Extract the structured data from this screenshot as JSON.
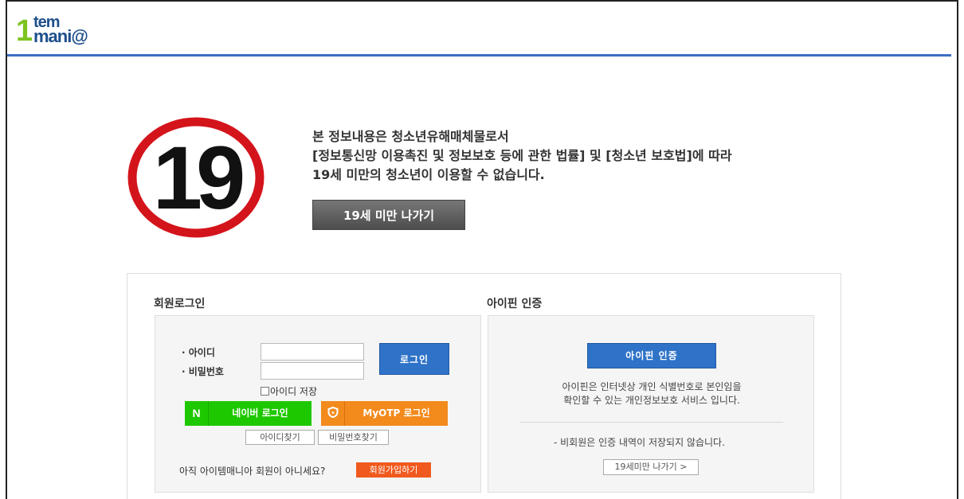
{
  "logo": {
    "one": "1",
    "tem": "tem",
    "mania": "mani@"
  },
  "age_badge": {
    "number": "19",
    "ring_color": "#d4141b"
  },
  "notice": {
    "line1": "본 정보내용은 청소년유해매체물로서",
    "line2": "[정보통신망 이용촉진 및 정보보호 등에 관한 법률] 및 [청소년 보호법]에 따라",
    "line3": "19세 미만의 청소년이 이용할 수 없습니다."
  },
  "exit_button_label": "19세 미만 나가기",
  "member_login": {
    "title": "회원로그인",
    "id_label": "· 아이디",
    "pw_label": "· 비밀번호",
    "id_value": "",
    "pw_value": "",
    "login_label": "로그인",
    "save_id_label": "아이디 저장",
    "naver_icon": "N",
    "naver_label": "네이버 로그인",
    "otp_icon": "shield-icon",
    "otp_label": "MyOTP 로그인",
    "find_id_label": "아이디찾기",
    "find_pw_label": "비밀번호찾기",
    "join_prompt": "아직 아이템매니아 회원이 아니세요?",
    "join_label": "회원가입하기"
  },
  "ipin": {
    "title": "아이핀 인증",
    "button_label": "아이핀 인증",
    "desc_line1": "아이핀은 인터넷상 개인 식별번호로 본인임을",
    "desc_line2": "확인할 수 있는 개인정보보호 서비스 입니다.",
    "note": "- 비회원은 인증 내역이 저장되지 않습니다.",
    "exit_label": "19세미만 나가기  >"
  },
  "colors": {
    "brand_blue": "#1d4f8c",
    "brand_green": "#7cc31f",
    "header_line": "#3b6fc4",
    "naver_green": "#1ec800",
    "otp_orange": "#f28a1c",
    "join_orange": "#f05a1e",
    "primary_button": "#2f73c8"
  }
}
